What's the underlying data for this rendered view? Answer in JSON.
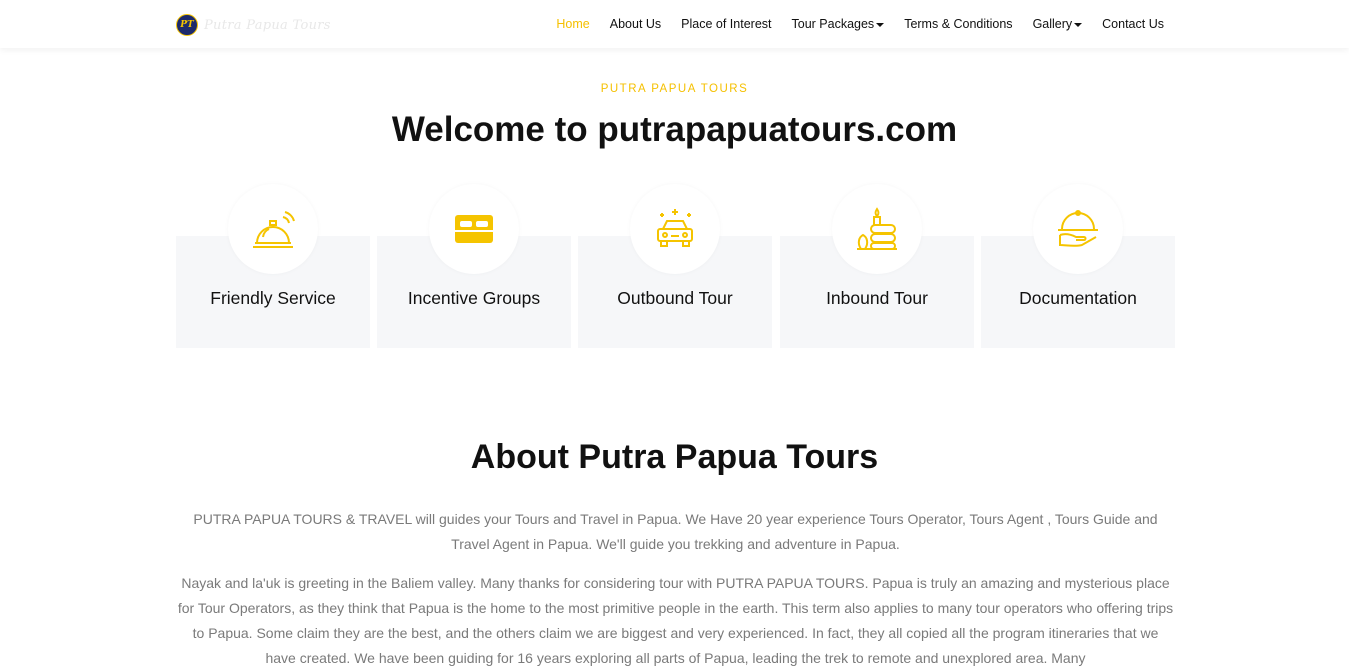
{
  "brand": {
    "badge": "PT",
    "name": "Putra Papua Tours"
  },
  "nav": {
    "items": [
      {
        "label": "Home",
        "active": true
      },
      {
        "label": "About Us"
      },
      {
        "label": "Place of Interest"
      },
      {
        "label": "Tour Packages",
        "dropdown": true
      },
      {
        "label": "Terms & Conditions"
      },
      {
        "label": "Gallery",
        "dropdown": true
      },
      {
        "label": "Contact Us"
      }
    ]
  },
  "hero": {
    "kicker": "PUTRA PAPUA TOURS",
    "title": "Welcome to putrapapuatours.com"
  },
  "services": [
    {
      "label": "Friendly Service",
      "icon": "service-bell-icon"
    },
    {
      "label": "Incentive Groups",
      "icon": "bed-icon"
    },
    {
      "label": "Outbound Tour",
      "icon": "car-icon"
    },
    {
      "label": "Inbound Tour",
      "icon": "spa-candle-icon"
    },
    {
      "label": "Documentation",
      "icon": "cloche-hand-icon"
    }
  ],
  "about": {
    "title": "About Putra Papua Tours",
    "p1": "PUTRA PAPUA TOURS & TRAVEL will guides your Tours and Travel in Papua. We Have 20 year experience Tours Operator, Tours Agent , Tours Guide and Travel Agent in Papua. We'll guide you trekking and adventure in Papua.",
    "p2": "Nayak and la'uk is greeting in the Baliem valley. Many thanks for considering tour with PUTRA PAPUA TOURS. Papua is truly an amazing and mysterious place for Tour Operators, as they think that Papua is the home to the most primitive people in the earth. This term also applies to many tour operators who offering trips to Papua. Some claim they are the best, and the others claim we are biggest and very experienced. In fact, they all copied all the program itineraries that we have created. We have been guiding for 16 years exploring all parts of Papua, leading the trek to remote and unexplored area. Many"
  },
  "colors": {
    "accent": "#f5c000",
    "card_bg": "#f6f7f9",
    "text": "#111111",
    "muted": "#7a7a7a"
  }
}
